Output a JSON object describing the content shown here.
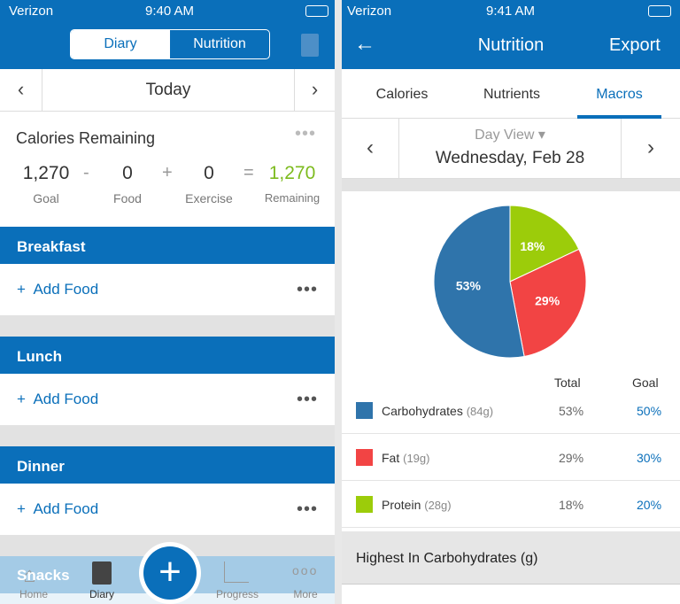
{
  "left": {
    "status": {
      "carrier": "Verizon",
      "time": "9:40 AM"
    },
    "segments": [
      "Diary",
      "Nutrition"
    ],
    "date": "Today",
    "calories": {
      "title": "Calories Remaining",
      "goal": "1,270",
      "goal_label": "Goal",
      "food": "0",
      "food_label": "Food",
      "exercise": "0",
      "exercise_label": "Exercise",
      "remaining": "1,270",
      "remaining_label": "Remaining",
      "minus": "-",
      "plus": "+",
      "equals": "="
    },
    "meals": [
      {
        "name": "Breakfast",
        "add": "Add Food"
      },
      {
        "name": "Lunch",
        "add": "Add Food"
      },
      {
        "name": "Dinner",
        "add": "Add Food"
      },
      {
        "name": "Snacks"
      }
    ],
    "tabs": [
      "Home",
      "Diary",
      "Progress",
      "More"
    ]
  },
  "right": {
    "status": {
      "carrier": "Verizon",
      "time": "9:41 AM"
    },
    "title": "Nutrition",
    "export": "Export",
    "tabs": [
      "Calories",
      "Nutrients",
      "Macros"
    ],
    "view": "Day View",
    "date": "Wednesday, Feb 28",
    "headers": {
      "total": "Total",
      "goal": "Goal"
    },
    "highest": "Highest In Carbohydrates (g)"
  },
  "colors": {
    "brand": "#0a6fba",
    "green": "#7dbb1e",
    "carbs": "#2f74ab",
    "fat": "#f24444",
    "protein": "#9ccc0a"
  },
  "chart_data": {
    "type": "pie",
    "slices": [
      {
        "name": "Carbohydrates",
        "amount": "(84g)",
        "value": 53,
        "label": "53%",
        "total": "53%",
        "goal": "50%"
      },
      {
        "name": "Fat",
        "amount": "(19g)",
        "value": 29,
        "label": "29%",
        "total": "29%",
        "goal": "30%"
      },
      {
        "name": "Protein",
        "amount": "(28g)",
        "value": 18,
        "label": "18%",
        "total": "18%",
        "goal": "20%"
      }
    ]
  }
}
